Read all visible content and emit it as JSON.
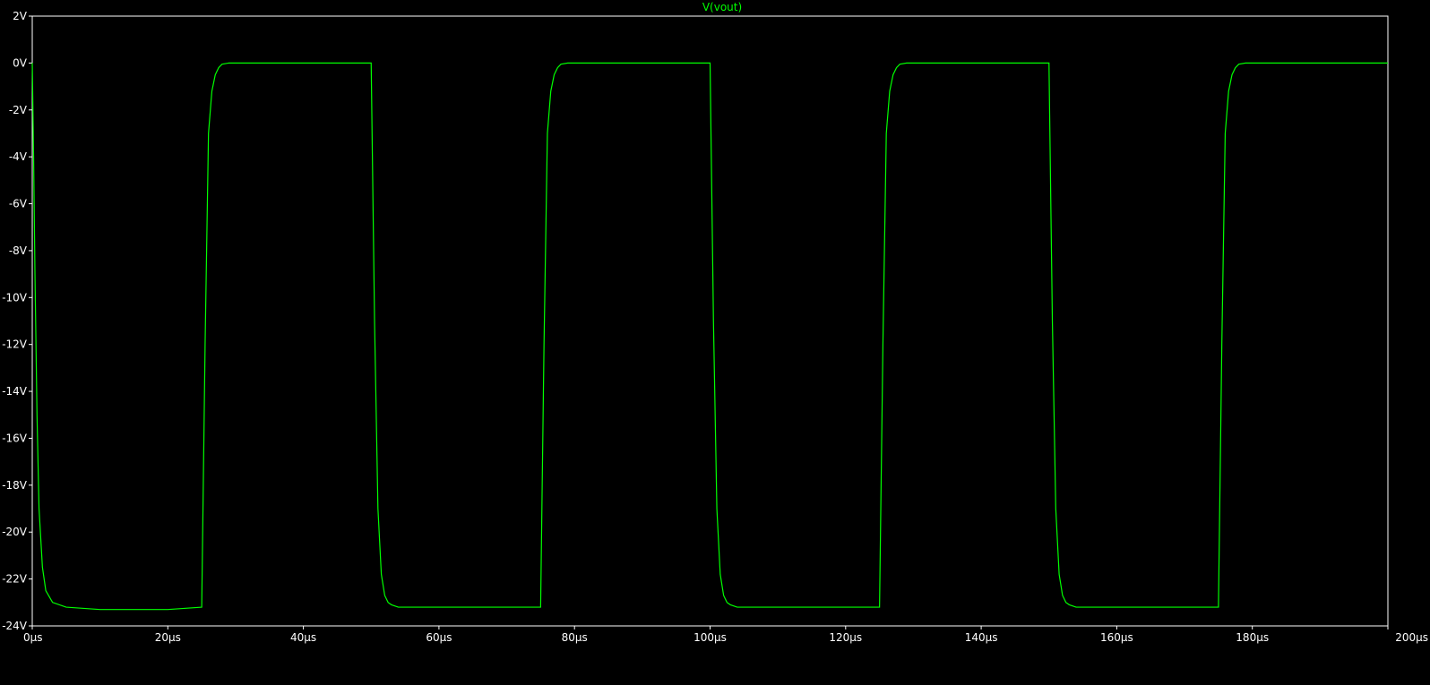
{
  "colors": {
    "background": "#000000",
    "frame": "#ffffff",
    "trace": "#00ff00",
    "text": "#ffffff"
  },
  "chart_data": {
    "type": "line",
    "title": "V(vout)",
    "xlabel": "",
    "ylabel": "",
    "grid": false,
    "xlim": [
      0,
      200
    ],
    "ylim": [
      -24,
      2
    ],
    "x_tick_labels": [
      "0µs",
      "20µs",
      "40µs",
      "60µs",
      "80µs",
      "100µs",
      "120µs",
      "140µs",
      "160µs",
      "180µs",
      "200µs"
    ],
    "y_tick_labels": [
      "2V",
      "0V",
      "-2V",
      "-4V",
      "-6V",
      "-8V",
      "-10V",
      "-12V",
      "-14V",
      "-16V",
      "-18V",
      "-20V",
      "-22V",
      "-24V"
    ],
    "series": [
      {
        "name": "V(vout)",
        "color": "#00ff00",
        "x": [
          0,
          0.2,
          0.4,
          0.7,
          1.0,
          1.5,
          2.0,
          3.0,
          5.0,
          10.0,
          20.0,
          25.0,
          25.5,
          26.0,
          26.5,
          27.0,
          27.5,
          28.0,
          29.0,
          30.0,
          40.0,
          50.0,
          50.5,
          51.0,
          51.5,
          52.0,
          52.5,
          53.0,
          54.0,
          55.0,
          60.0,
          75.0,
          75.5,
          76.0,
          76.5,
          77.0,
          77.5,
          78.0,
          79.0,
          80.0,
          90.0,
          100.0,
          100.5,
          101.0,
          101.5,
          102.0,
          102.5,
          103.0,
          104.0,
          105.0,
          110.0,
          125.0,
          125.5,
          126.0,
          126.5,
          127.0,
          127.5,
          128.0,
          129.0,
          130.0,
          140.0,
          150.0,
          150.5,
          151.0,
          151.5,
          152.0,
          152.5,
          153.0,
          154.0,
          155.0,
          160.0,
          175.0,
          175.5,
          176.0,
          176.5,
          177.0,
          177.5,
          178.0,
          179.0,
          180.0,
          190.0,
          200.0
        ],
        "y": [
          0,
          -4,
          -9,
          -15,
          -19,
          -21.5,
          -22.5,
          -23,
          -23.2,
          -23.3,
          -23.3,
          -23.2,
          -12,
          -3,
          -1.2,
          -0.5,
          -0.2,
          -0.05,
          0,
          0,
          0,
          0,
          -11,
          -19,
          -21.8,
          -22.7,
          -23,
          -23.1,
          -23.2,
          -23.2,
          -23.2,
          -23.2,
          -12,
          -3,
          -1.2,
          -0.5,
          -0.2,
          -0.05,
          0,
          0,
          0,
          0,
          -11,
          -19,
          -21.8,
          -22.7,
          -23,
          -23.1,
          -23.2,
          -23.2,
          -23.2,
          -23.2,
          -12,
          -3,
          -1.2,
          -0.5,
          -0.2,
          -0.05,
          0,
          0,
          0,
          0,
          -11,
          -19,
          -21.8,
          -22.7,
          -23,
          -23.1,
          -23.2,
          -23.2,
          -23.2,
          -23.2,
          -12,
          -3,
          -1.2,
          -0.5,
          -0.2,
          -0.05,
          0,
          0,
          0,
          0
        ]
      }
    ]
  }
}
